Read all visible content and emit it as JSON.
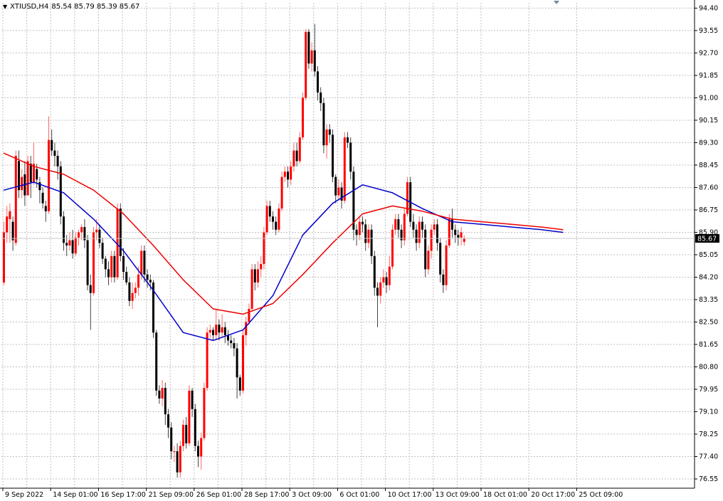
{
  "info": {
    "arrow": "▼",
    "symbol": "XTIUSD,H4",
    "ohlc": "85.54 85.79 85.39 85.67"
  },
  "current_price": "85.67",
  "colors": {
    "bull": "#ff0000",
    "bear": "#000000",
    "ma_fast": "#0000cc",
    "ma_slow": "#ee0000",
    "grid": "#c0c0c0",
    "price_tag": "#000000"
  },
  "chart_data": {
    "type": "candlestick",
    "title": "",
    "ylim": [
      76.2,
      94.6
    ],
    "y_ticks": [
      "94.40",
      "93.55",
      "92.70",
      "91.85",
      "91.00",
      "90.15",
      "89.30",
      "88.45",
      "87.60",
      "86.75",
      "85.90",
      "85.05",
      "84.20",
      "83.35",
      "82.50",
      "81.65",
      "80.80",
      "79.95",
      "79.10",
      "78.25",
      "77.40",
      "76.55"
    ],
    "x_ticks": [
      "9 Sep 2022",
      "14 Sep 01:00",
      "16 Sep 17:00",
      "21 Sep 09:00",
      "26 Sep 01:00",
      "28 Sep 17:00",
      "3 Oct 09:00",
      "6 Oct 01:00",
      "10 Oct 17:00",
      "13 Oct 09:00",
      "18 Oct 01:00",
      "20 Oct 17:00",
      "25 Oct 09:00"
    ],
    "x_tick_index": [
      0,
      16,
      32,
      48,
      64,
      80,
      96,
      112,
      128,
      144,
      160,
      176,
      192
    ],
    "candles": [
      [
        84.0,
        85.9,
        83.9,
        86.3
      ],
      [
        85.9,
        86.5,
        85.5,
        86.9
      ],
      [
        86.4,
        86.7,
        85.5,
        87.0
      ],
      [
        86.3,
        85.6,
        85.2,
        86.5
      ],
      [
        85.5,
        88.8,
        85.4,
        89.0
      ],
      [
        88.6,
        87.5,
        87.2,
        89.0
      ],
      [
        87.5,
        88.0,
        87.2,
        88.3
      ],
      [
        88.1,
        87.3,
        86.9,
        88.6
      ],
      [
        87.3,
        88.6,
        87.3,
        88.8
      ],
      [
        88.5,
        87.8,
        87.2,
        88.8
      ],
      [
        87.8,
        88.5,
        87.7,
        89.3
      ],
      [
        88.3,
        87.9,
        87.6,
        88.5
      ],
      [
        87.8,
        87.5,
        87.0,
        88.0
      ],
      [
        87.4,
        87.0,
        86.8,
        87.6
      ],
      [
        86.9,
        86.7,
        86.3,
        87.1
      ],
      [
        86.7,
        89.4,
        86.6,
        90.3
      ],
      [
        89.4,
        89.0,
        88.8,
        89.8
      ],
      [
        89.0,
        88.8,
        88.4,
        89.3
      ],
      [
        88.8,
        88.4,
        87.9,
        89.0
      ],
      [
        88.4,
        86.5,
        86.2,
        88.6
      ],
      [
        86.5,
        85.5,
        85.2,
        86.7
      ],
      [
        85.5,
        85.4,
        85.0,
        85.8
      ],
      [
        85.4,
        85.6,
        85.2,
        85.9
      ],
      [
        85.6,
        85.1,
        84.9,
        86.0
      ],
      [
        85.1,
        85.7,
        85.0,
        85.9
      ],
      [
        85.7,
        85.9,
        85.4,
        86.0
      ],
      [
        85.9,
        86.1,
        85.6,
        86.2
      ],
      [
        86.1,
        85.6,
        85.3,
        86.4
      ],
      [
        85.6,
        83.9,
        83.7,
        85.8
      ],
      [
        83.9,
        83.6,
        82.2,
        84.3
      ],
      [
        83.6,
        85.9,
        83.5,
        86.1
      ],
      [
        85.9,
        86.0,
        85.6,
        86.4
      ],
      [
        86.0,
        85.5,
        85.3,
        86.2
      ],
      [
        85.5,
        84.9,
        84.7,
        85.7
      ],
      [
        84.9,
        84.5,
        84.2,
        85.0
      ],
      [
        84.5,
        84.2,
        83.9,
        84.8
      ],
      [
        84.2,
        85.0,
        84.0,
        85.2
      ],
      [
        85.0,
        84.2,
        84.0,
        85.2
      ],
      [
        84.2,
        86.8,
        84.1,
        87.0
      ],
      [
        86.8,
        85.0,
        84.8,
        87.0
      ],
      [
        85.0,
        84.4,
        84.1,
        85.3
      ],
      [
        84.4,
        84.0,
        83.9,
        84.6
      ],
      [
        84.0,
        83.3,
        83.1,
        84.2
      ],
      [
        83.3,
        83.6,
        83.0,
        84.0
      ],
      [
        83.6,
        83.8,
        83.4,
        84.0
      ],
      [
        83.8,
        84.3,
        83.5,
        84.6
      ],
      [
        84.3,
        85.2,
        84.1,
        85.4
      ],
      [
        85.2,
        84.3,
        84.0,
        85.4
      ],
      [
        84.3,
        84.1,
        83.8,
        84.5
      ],
      [
        84.1,
        84.0,
        83.7,
        84.3
      ],
      [
        84.0,
        82.1,
        81.9,
        84.1
      ],
      [
        82.1,
        79.9,
        79.7,
        82.2
      ],
      [
        79.9,
        79.6,
        79.4,
        80.1
      ],
      [
        79.6,
        80.0,
        79.3,
        80.3
      ],
      [
        80.0,
        79.0,
        78.6,
        80.2
      ],
      [
        79.0,
        78.5,
        78.1,
        79.2
      ],
      [
        78.5,
        77.6,
        77.3,
        78.7
      ],
      [
        77.6,
        77.6,
        77.2,
        77.8
      ],
      [
        77.6,
        76.8,
        76.6,
        77.9
      ],
      [
        76.8,
        77.8,
        76.6,
        78.0
      ],
      [
        77.8,
        78.6,
        77.6,
        78.8
      ],
      [
        78.6,
        77.9,
        77.7,
        78.9
      ],
      [
        77.9,
        79.9,
        77.8,
        80.1
      ],
      [
        79.9,
        79.2,
        78.9,
        80.0
      ],
      [
        79.2,
        77.8,
        77.6,
        79.4
      ],
      [
        77.8,
        77.4,
        77.0,
        78.0
      ],
      [
        77.4,
        78.1,
        76.9,
        78.3
      ],
      [
        78.1,
        80.0,
        78.0,
        80.2
      ],
      [
        80.0,
        82.1,
        79.9,
        82.3
      ],
      [
        82.1,
        82.2,
        81.9,
        82.4
      ],
      [
        82.2,
        82.0,
        81.8,
        82.3
      ],
      [
        82.0,
        82.4,
        81.8,
        83.0
      ],
      [
        82.4,
        82.1,
        81.8,
        82.6
      ],
      [
        82.1,
        82.3,
        81.9,
        82.8
      ],
      [
        82.3,
        82.0,
        81.7,
        82.5
      ],
      [
        82.0,
        81.8,
        81.6,
        82.2
      ],
      [
        81.8,
        81.7,
        81.5,
        82.0
      ],
      [
        81.7,
        81.5,
        81.2,
        81.9
      ],
      [
        81.5,
        80.4,
        79.6,
        81.7
      ],
      [
        80.4,
        79.9,
        79.7,
        80.5
      ],
      [
        79.9,
        82.0,
        79.8,
        82.2
      ],
      [
        82.0,
        82.5,
        81.6,
        82.7
      ],
      [
        82.5,
        83.0,
        82.4,
        83.2
      ],
      [
        83.0,
        84.5,
        82.9,
        84.7
      ],
      [
        84.5,
        84.0,
        83.7,
        84.7
      ],
      [
        84.0,
        84.5,
        83.8,
        84.8
      ],
      [
        84.5,
        84.7,
        84.2,
        85.0
      ],
      [
        84.7,
        85.9,
        84.5,
        86.1
      ],
      [
        85.9,
        86.9,
        85.8,
        87.1
      ],
      [
        86.9,
        86.5,
        86.3,
        87.1
      ],
      [
        86.5,
        86.3,
        86.0,
        86.7
      ],
      [
        86.3,
        86.0,
        85.8,
        86.5
      ],
      [
        86.0,
        86.8,
        85.9,
        87.0
      ],
      [
        86.8,
        88.0,
        86.7,
        88.2
      ],
      [
        88.0,
        88.2,
        87.8,
        88.4
      ],
      [
        88.2,
        87.9,
        87.6,
        88.4
      ],
      [
        87.9,
        88.4,
        87.7,
        88.6
      ],
      [
        88.4,
        89.0,
        88.2,
        89.3
      ],
      [
        89.0,
        88.6,
        88.4,
        89.3
      ],
      [
        88.6,
        89.5,
        88.5,
        89.7
      ],
      [
        89.5,
        91.0,
        89.4,
        91.2
      ],
      [
        91.0,
        93.5,
        90.9,
        93.6
      ],
      [
        93.5,
        92.3,
        92.1,
        93.6
      ],
      [
        92.3,
        92.8,
        92.0,
        93.1
      ],
      [
        92.8,
        92.0,
        91.8,
        93.8
      ],
      [
        92.0,
        91.2,
        90.9,
        92.2
      ],
      [
        91.2,
        90.8,
        90.5,
        91.4
      ],
      [
        90.8,
        89.2,
        88.9,
        91.0
      ],
      [
        89.2,
        89.8,
        88.7,
        90.0
      ],
      [
        89.8,
        89.6,
        89.3,
        90.0
      ],
      [
        89.6,
        88.0,
        87.8,
        89.8
      ],
      [
        88.0,
        87.3,
        87.0,
        88.1
      ],
      [
        87.3,
        87.6,
        87.1,
        87.9
      ],
      [
        87.6,
        87.1,
        86.8,
        87.8
      ],
      [
        87.1,
        89.5,
        87.0,
        89.7
      ],
      [
        89.5,
        89.3,
        89.1,
        89.7
      ],
      [
        89.3,
        88.2,
        87.9,
        89.5
      ],
      [
        88.2,
        86.0,
        85.6,
        88.4
      ],
      [
        86.0,
        85.8,
        85.4,
        86.2
      ],
      [
        85.8,
        86.3,
        85.6,
        86.5
      ],
      [
        86.3,
        86.2,
        85.9,
        86.5
      ],
      [
        86.2,
        85.5,
        85.2,
        86.4
      ],
      [
        85.5,
        86.0,
        85.3,
        86.2
      ],
      [
        86.0,
        85.0,
        84.7,
        86.2
      ],
      [
        85.0,
        83.8,
        83.5,
        85.2
      ],
      [
        83.8,
        83.5,
        82.3,
        84.0
      ],
      [
        83.5,
        84.0,
        83.2,
        84.2
      ],
      [
        84.0,
        84.2,
        83.8,
        84.5
      ],
      [
        84.2,
        83.9,
        83.6,
        84.4
      ],
      [
        83.9,
        84.6,
        83.7,
        85.0
      ],
      [
        84.6,
        86.0,
        84.5,
        86.2
      ],
      [
        86.0,
        86.4,
        85.8,
        86.6
      ],
      [
        86.4,
        86.0,
        85.7,
        86.6
      ],
      [
        86.0,
        85.6,
        85.3,
        86.2
      ],
      [
        85.6,
        86.6,
        85.4,
        86.8
      ],
      [
        86.6,
        87.8,
        86.5,
        88.0
      ],
      [
        87.8,
        86.3,
        86.1,
        88.0
      ],
      [
        86.3,
        86.0,
        85.7,
        86.6
      ],
      [
        86.0,
        85.5,
        85.2,
        86.2
      ],
      [
        85.5,
        86.3,
        85.3,
        86.5
      ],
      [
        86.3,
        86.0,
        85.7,
        86.5
      ],
      [
        86.0,
        84.5,
        84.2,
        86.2
      ],
      [
        84.5,
        85.2,
        84.3,
        85.4
      ],
      [
        85.2,
        86.0,
        84.9,
        86.2
      ],
      [
        86.0,
        86.2,
        85.8,
        86.4
      ],
      [
        86.2,
        85.5,
        85.2,
        86.4
      ],
      [
        85.5,
        84.3,
        84.0,
        85.7
      ],
      [
        84.3,
        83.9,
        83.6,
        84.5
      ],
      [
        83.9,
        85.4,
        83.7,
        85.6
      ],
      [
        85.4,
        86.4,
        85.3,
        86.6
      ],
      [
        86.4,
        86.0,
        85.7,
        86.8
      ],
      [
        86.0,
        85.8,
        85.5,
        86.2
      ],
      [
        85.8,
        85.7,
        85.4,
        86.0
      ],
      [
        85.7,
        85.9,
        85.4,
        86.1
      ],
      [
        85.54,
        85.67,
        85.39,
        85.79
      ]
    ],
    "series": [
      {
        "type": "line",
        "x": [
          0,
          10,
          20,
          30,
          40,
          50,
          60,
          70,
          80,
          90,
          100,
          110,
          120,
          130,
          140,
          150,
          160,
          170,
          180,
          187
        ],
        "values": [
          87.5,
          87.8,
          87.4,
          86.4,
          85.2,
          83.7,
          82.1,
          81.8,
          82.2,
          83.5,
          85.8,
          87.0,
          87.7,
          87.4,
          86.8,
          86.3,
          86.2,
          86.1,
          86.0,
          85.9
        ]
      },
      {
        "type": "line",
        "x": [
          0,
          10,
          20,
          30,
          40,
          50,
          60,
          70,
          80,
          90,
          100,
          110,
          120,
          130,
          140,
          150,
          160,
          170,
          180,
          187
        ],
        "values": [
          88.9,
          88.4,
          88.1,
          87.5,
          86.6,
          85.4,
          84.1,
          83.0,
          82.8,
          83.2,
          84.3,
          85.5,
          86.6,
          86.9,
          86.7,
          86.4,
          86.3,
          86.2,
          86.1,
          86.0
        ]
      }
    ]
  }
}
